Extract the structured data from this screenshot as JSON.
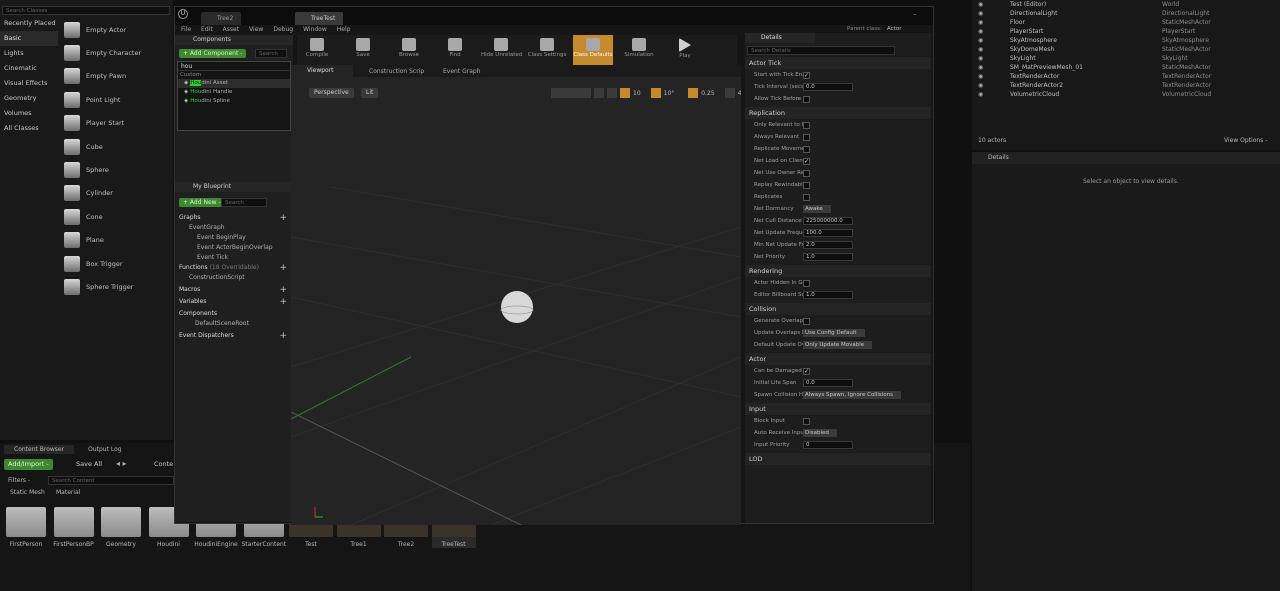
{
  "place": {
    "search_placeholder": "Search Classes",
    "categories": [
      "Recently Placed",
      "Basic",
      "Lights",
      "Cinematic",
      "Visual Effects",
      "Geometry",
      "Volumes",
      "All Classes"
    ],
    "items": [
      "Empty Actor",
      "Empty Character",
      "Empty Pawn",
      "Point Light",
      "Player Start",
      "Cube",
      "Sphere",
      "Cylinder",
      "Cone",
      "Plane",
      "Box Trigger",
      "Sphere Trigger"
    ]
  },
  "editor": {
    "tabs": [
      "Tree2",
      "TreeTest"
    ],
    "menus": [
      "File",
      "Edit",
      "Asset",
      "View",
      "Debug",
      "Window",
      "Help"
    ],
    "parent_class_label": "Parent class:",
    "parent_class_value": "Actor",
    "toolbar": [
      "Compile",
      "Save",
      "Browse",
      "Find",
      "Hide Unrelated",
      "Class Settings",
      "Class Defaults",
      "Simulation",
      "Play"
    ],
    "components": {
      "title": "Components",
      "add_label": "+ Add Component -",
      "search_placeholder": "Search",
      "filter_value": "hou",
      "custom_label": "Custom",
      "results": [
        {
          "hl": "Hou",
          "rest": "dini Asset"
        },
        {
          "hl": "Hou",
          "rest": "dini Handle"
        },
        {
          "hl": "Hou",
          "rest": "dini Spline"
        }
      ]
    },
    "mybp": {
      "title": "My Blueprint",
      "add_new": "+ Add New -",
      "search_placeholder": "Search",
      "graphs": "Graphs",
      "event_graph": "EventGraph",
      "events": [
        "Event BeginPlay",
        "Event ActorBeginOverlap",
        "Event Tick"
      ],
      "functions": "Functions",
      "functions_note": "(18 Overridable)",
      "construction": "ConstructionScript",
      "macros": "Macros",
      "variables": "Variables",
      "components": "Components",
      "default_root": "DefaultSceneRoot",
      "dispatchers": "Event Dispatchers"
    },
    "view_tabs": [
      "Viewport",
      "Construction Scrip",
      "Event Graph"
    ],
    "perspective": "Perspective",
    "lit": "Lit",
    "vp_numbers": [
      "10",
      "10°",
      "0.25",
      "4"
    ],
    "details": {
      "title": "Details",
      "search_placeholder": "Search Details",
      "sections": [
        {
          "name": "Actor Tick",
          "rows": [
            {
              "l": "Start with Tick Enable",
              "t": "chk",
              "v": "✓"
            },
            {
              "l": "Tick Interval (secs)",
              "t": "num",
              "v": "0.0"
            },
            {
              "l": "Allow Tick Before Beg",
              "t": "chk",
              "v": ""
            }
          ]
        },
        {
          "name": "Replication",
          "rows": [
            {
              "l": "Only Relevant to Own",
              "t": "chk",
              "v": ""
            },
            {
              "l": "Always Relevant",
              "t": "chk",
              "v": ""
            },
            {
              "l": "Replicate Movement",
              "t": "chk",
              "v": ""
            },
            {
              "l": "Net Load on Client",
              "t": "chk",
              "v": "✓"
            },
            {
              "l": "Net Use Owner Relev",
              "t": "chk",
              "v": ""
            },
            {
              "l": "Replay Rewindable",
              "t": "chk",
              "v": ""
            },
            {
              "l": "Replicates",
              "t": "chk",
              "v": ""
            },
            {
              "l": "Net Dormancy",
              "t": "drop",
              "v": "Awake"
            },
            {
              "l": "Net Cull Distance Squ",
              "t": "num",
              "v": "225000000.0"
            },
            {
              "l": "Net Update Frequenc",
              "t": "num",
              "v": "100.0"
            },
            {
              "l": "Min Net Update Frequ",
              "t": "num",
              "v": "2.0"
            },
            {
              "l": "Net Priority",
              "t": "num",
              "v": "1.0"
            }
          ]
        },
        {
          "name": "Rendering",
          "rows": [
            {
              "l": "Actor Hidden In Game",
              "t": "chk",
              "v": ""
            },
            {
              "l": "Editor Billboard Scale",
              "t": "num",
              "v": "1.0"
            }
          ]
        },
        {
          "name": "Collision",
          "rows": [
            {
              "l": "Generate Overlap Eve",
              "t": "chk",
              "v": ""
            },
            {
              "l": "Update Overlaps Met",
              "t": "drop",
              "v": "Use Config Default"
            },
            {
              "l": "Default Update Overl",
              "t": "drop",
              "v": "Only Update Movable"
            }
          ]
        },
        {
          "name": "Actor",
          "rows": [
            {
              "l": "Can be Damaged",
              "t": "chk",
              "v": "✓"
            },
            {
              "l": "Initial Life Span",
              "t": "num",
              "v": "0.0"
            },
            {
              "l": "Spawn Collision Hand",
              "t": "drop",
              "v": "Always Spawn, Ignore Collisions"
            }
          ]
        },
        {
          "name": "Input",
          "rows": [
            {
              "l": "Block Input",
              "t": "chk",
              "v": ""
            },
            {
              "l": "Auto Receive Input",
              "t": "drop",
              "v": "Disabled"
            },
            {
              "l": "Input Priority",
              "t": "num",
              "v": "0"
            }
          ]
        },
        {
          "name": "LOD",
          "rows": []
        }
      ]
    }
  },
  "outliner": {
    "rows": [
      [
        "Test (Editor)",
        "World"
      ],
      [
        "DirectionalLight",
        "DirectionalLight"
      ],
      [
        "Floor",
        "StaticMeshActor"
      ],
      [
        "PlayerStart",
        "PlayerStart"
      ],
      [
        "SkyAtmosphere",
        "SkyAtmosphere"
      ],
      [
        "SkyDomeMesh",
        "StaticMeshActor"
      ],
      [
        "SkyLight",
        "SkyLight"
      ],
      [
        "SM_MatPreviewMesh_01",
        "StaticMeshActor"
      ],
      [
        "TextRenderActor",
        "TextRenderActor"
      ],
      [
        "TextRenderActor2",
        "TextRenderActor"
      ],
      [
        "VolumetricCloud",
        "VolumetricCloud"
      ]
    ],
    "count": "10 actors",
    "view_options": "View Options -"
  },
  "right_details": {
    "title": "Details",
    "empty": "Select an object to view details."
  },
  "content": {
    "tabs": [
      "Content Browser",
      "Output Log"
    ],
    "add_import": "Add/Import -",
    "save_all": "Save All",
    "path": "Conte",
    "filters": "Filters -",
    "search_placeholder": "Search Content",
    "chips": [
      "Static Mesh",
      "Material"
    ],
    "assets": [
      "FirstPerson",
      "FirstPersonBP",
      "Geometry",
      "Houdini",
      "HoudiniEngine",
      "StarterContent",
      "Test",
      "Tree1",
      "Tree2",
      "TreeTest"
    ]
  }
}
